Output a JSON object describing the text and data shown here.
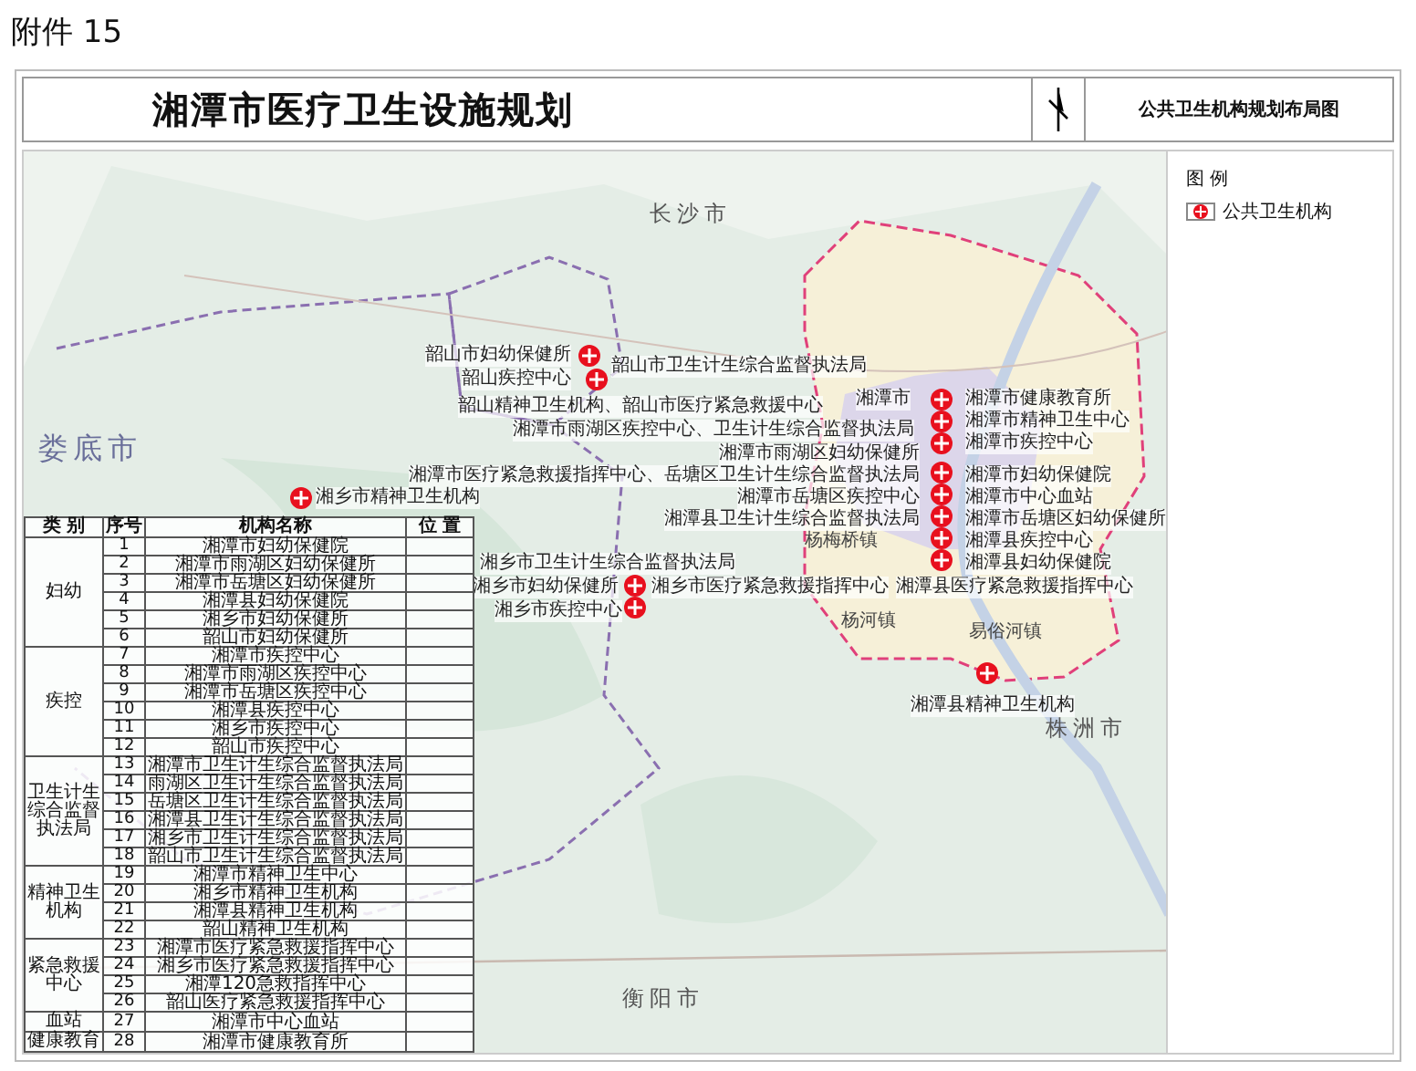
{
  "attachment_label": "附件 15",
  "title": "湘潭市医疗卫生设施规划",
  "subtitle": "公共卫生机构规划布局图",
  "legend": {
    "title": "图 例",
    "items": [
      {
        "label": "公共卫生机构"
      }
    ]
  },
  "map_labels": [
    {
      "text": "长沙市",
      "kind": "region"
    },
    {
      "text": "韶山市妇幼保健所",
      "kind": "facility"
    },
    {
      "text": "韶山市卫生计生综合监督执法局",
      "kind": "facility"
    },
    {
      "text": "韶山疾控中心",
      "kind": "facility"
    },
    {
      "text": "湘潭市",
      "kind": "facility"
    },
    {
      "text": "湘潭市健康教育所",
      "kind": "facility"
    },
    {
      "text": "韶山精神卫生机构、韶山市医疗紧急救援中心",
      "kind": "facility"
    },
    {
      "text": "湘潭市精神卫生中心",
      "kind": "facility"
    },
    {
      "text": "湘潭市雨湖区疾控中心、卫生计生综合监督执法局",
      "kind": "facility"
    },
    {
      "text": "娄底市",
      "kind": "region_large"
    },
    {
      "text": "湘潭市疾控中心",
      "kind": "facility"
    },
    {
      "text": "湘潭市雨湖区妇幼保健所",
      "kind": "facility"
    },
    {
      "text": "湘潭市医疗紧急救援指挥中心、岳塘区卫生计生综合监督执法局",
      "kind": "facility"
    },
    {
      "text": "湘潭市妇幼保健院",
      "kind": "facility"
    },
    {
      "text": "湘乡市精神卫生机构",
      "kind": "facility"
    },
    {
      "text": "湘潭市岳塘区疾控中心",
      "kind": "facility"
    },
    {
      "text": "湘潭市中心血站",
      "kind": "facility"
    },
    {
      "text": "湘潭县卫生计生综合监督执法局",
      "kind": "facility"
    },
    {
      "text": "湘潭市岳塘区妇幼保健所",
      "kind": "facility"
    },
    {
      "text": "杨梅桥镇",
      "kind": "town"
    },
    {
      "text": "湘潭县疾控中心",
      "kind": "facility"
    },
    {
      "text": "湘乡市卫生计生综合监督执法局",
      "kind": "facility"
    },
    {
      "text": "湘潭县妇幼保健院",
      "kind": "facility"
    },
    {
      "text": "湘乡市妇幼保健所",
      "kind": "facility"
    },
    {
      "text": "湘乡市医疗紧急救援指挥中心",
      "kind": "facility"
    },
    {
      "text": "湘潭县医疗紧急救援指挥中心",
      "kind": "facility"
    },
    {
      "text": "湘乡市疾控中心",
      "kind": "facility"
    },
    {
      "text": "杨河镇",
      "kind": "town"
    },
    {
      "text": "易俗河镇",
      "kind": "town"
    },
    {
      "text": "湘潭县精神卫生机构",
      "kind": "facility"
    },
    {
      "text": "株洲市",
      "kind": "region"
    },
    {
      "text": "衡阳市",
      "kind": "region"
    }
  ],
  "table": {
    "columns": [
      "类 别",
      "序号",
      "机构名称",
      "位 置"
    ],
    "groups": [
      {
        "category": "妇幼",
        "rows": [
          {
            "no": "1",
            "name": "湘潭市妇幼保健院"
          },
          {
            "no": "2",
            "name": "湘潭市雨湖区妇幼保健所"
          },
          {
            "no": "3",
            "name": "湘潭市岳塘区妇幼保健所"
          },
          {
            "no": "4",
            "name": "湘潭县妇幼保健院"
          },
          {
            "no": "5",
            "name": "湘乡市妇幼保健所"
          },
          {
            "no": "6",
            "name": "韶山市妇幼保健所"
          }
        ]
      },
      {
        "category": "疾控",
        "rows": [
          {
            "no": "7",
            "name": "湘潭市疾控中心"
          },
          {
            "no": "8",
            "name": "湘潭市雨湖区疾控中心"
          },
          {
            "no": "9",
            "name": "湘潭市岳塘区疾控中心"
          },
          {
            "no": "10",
            "name": "湘潭县疾控中心"
          },
          {
            "no": "11",
            "name": "湘乡市疾控中心"
          },
          {
            "no": "12",
            "name": "韶山市疾控中心"
          }
        ]
      },
      {
        "category": "卫生计生综合监督执法局",
        "rows": [
          {
            "no": "13",
            "name": "湘潭市卫生计生综合监督执法局"
          },
          {
            "no": "14",
            "name": "雨湖区卫生计生综合监督执法局"
          },
          {
            "no": "15",
            "name": "岳塘区卫生计生综合监督执法局"
          },
          {
            "no": "16",
            "name": "湘潭县卫生计生综合监督执法局"
          },
          {
            "no": "17",
            "name": "湘乡市卫生计生综合监督执法局"
          },
          {
            "no": "18",
            "name": "韶山市卫生计生综合监督执法局"
          }
        ]
      },
      {
        "category": "精神卫生机构",
        "rows": [
          {
            "no": "19",
            "name": "湘潭市精神卫生中心"
          },
          {
            "no": "20",
            "name": "湘乡市精神卫生机构"
          },
          {
            "no": "21",
            "name": "湘潭县精神卫生机构"
          },
          {
            "no": "22",
            "name": "韶山精神卫生机构"
          }
        ]
      },
      {
        "category": "紧急救援中心",
        "rows": [
          {
            "no": "23",
            "name": "湘潭市医疗紧急救援指挥中心"
          },
          {
            "no": "24",
            "name": "湘乡市医疗紧急救援指挥中心"
          },
          {
            "no": "25",
            "name": "湘潭120急救指挥中心"
          },
          {
            "no": "26",
            "name": "韶山医疗紧急救援指挥中心"
          }
        ]
      },
      {
        "category": "血站",
        "rows": [
          {
            "no": "27",
            "name": "湘潭市中心血站"
          }
        ]
      },
      {
        "category": "健康教育",
        "rows": [
          {
            "no": "28",
            "name": "湘潭市健康教育所"
          }
        ]
      }
    ]
  }
}
